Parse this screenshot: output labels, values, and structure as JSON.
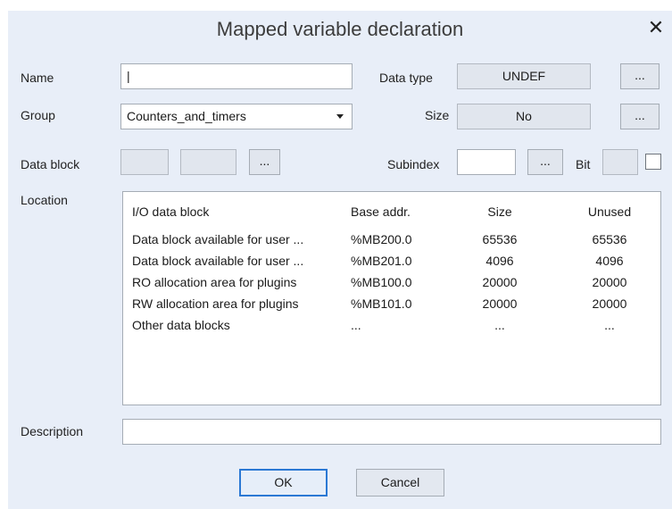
{
  "dialog": {
    "title": "Mapped variable declaration",
    "close": "✕"
  },
  "labels": {
    "name": "Name",
    "group": "Group",
    "data_block": "Data block",
    "location": "Location",
    "description": "Description",
    "data_type": "Data type",
    "size": "Size",
    "subindex": "Subindex",
    "bit": "Bit"
  },
  "fields": {
    "name_value": "|",
    "group_value": "Counters_and_timers",
    "data_type_value": "UNDEF",
    "size_value": "No",
    "description_value": "",
    "browse_label": "..."
  },
  "location_table": {
    "headers": [
      "I/O data block",
      "Base addr.",
      "Size",
      "Unused"
    ],
    "rows": [
      [
        "Data block available for user ...",
        "%MB200.0",
        "65536",
        "65536"
      ],
      [
        "Data block available for user ...",
        "%MB201.0",
        "4096",
        "4096"
      ],
      [
        "RO allocation area for plugins",
        "%MB100.0",
        "20000",
        "20000"
      ],
      [
        "RW allocation area for plugins",
        "%MB101.0",
        "20000",
        "20000"
      ],
      [
        "Other data blocks",
        "...",
        "...",
        "..."
      ]
    ]
  },
  "buttons": {
    "ok": "OK",
    "cancel": "Cancel"
  }
}
